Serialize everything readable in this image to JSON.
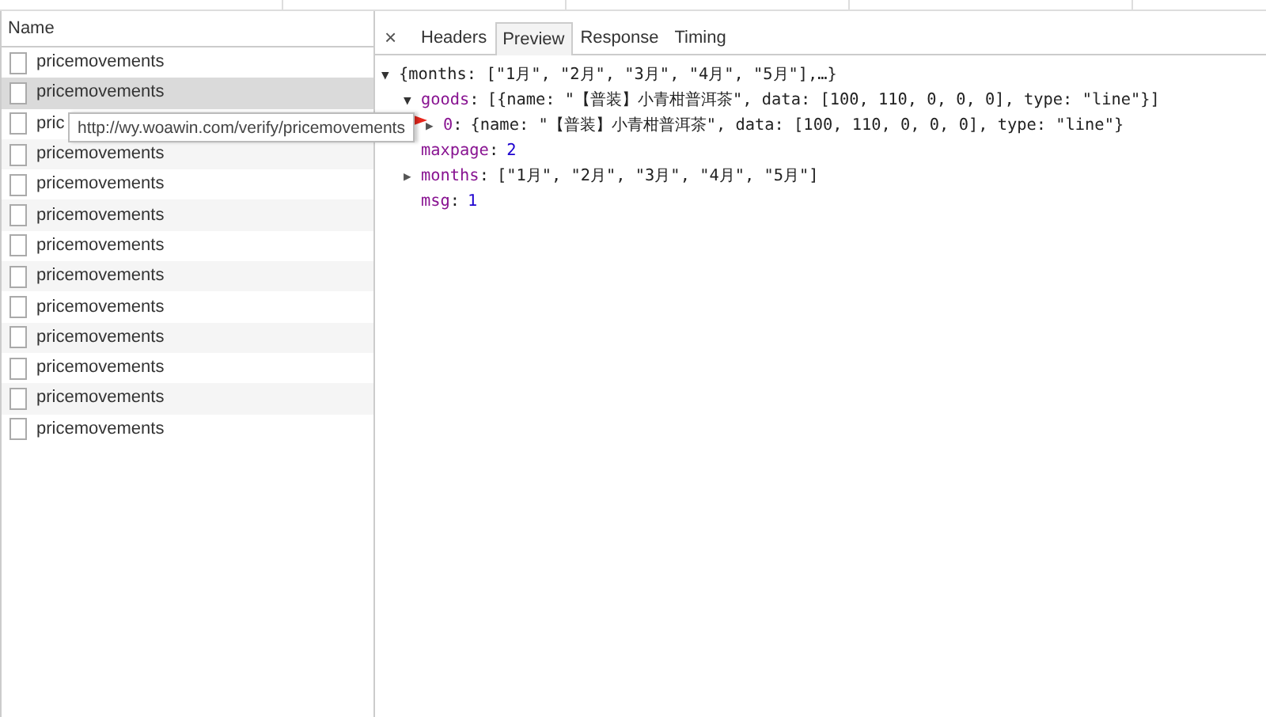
{
  "requests": {
    "column_header": "Name",
    "rows": [
      {
        "name": "pricemovements",
        "selected": false
      },
      {
        "name": "pricemovements",
        "selected": true
      },
      {
        "name": "pric",
        "selected": false
      },
      {
        "name": "pricemovements",
        "selected": false
      },
      {
        "name": "pricemovements",
        "selected": false
      },
      {
        "name": "pricemovements",
        "selected": false
      },
      {
        "name": "pricemovements",
        "selected": false
      },
      {
        "name": "pricemovements",
        "selected": false
      },
      {
        "name": "pricemovements",
        "selected": false
      },
      {
        "name": "pricemovements",
        "selected": false
      },
      {
        "name": "pricemovements",
        "selected": false
      },
      {
        "name": "pricemovements",
        "selected": false
      },
      {
        "name": "pricemovements",
        "selected": false
      }
    ],
    "tooltip": "http://wy.woawin.com/verify/pricemovements"
  },
  "details": {
    "close": "×",
    "tabs": [
      {
        "label": "Headers",
        "selected": false
      },
      {
        "label": "Preview",
        "selected": true
      },
      {
        "label": "Response",
        "selected": false
      },
      {
        "label": "Timing",
        "selected": false
      }
    ],
    "tree": [
      {
        "twisty": "▼",
        "value": "{months: [\"1月\", \"2月\", \"3月\", \"4月\", \"5月\"],…}",
        "kind": "text",
        "expanded": true,
        "children": [
          {
            "twisty": "▼",
            "key": "goods",
            "sep": ":",
            "value": "[{name: \"【普装】小青柑普洱茶\", data: [100, 110, 0, 0, 0], type: \"line\"}]",
            "kind": "text",
            "expanded": true,
            "children": [
              {
                "twisty": "▶",
                "key": "0",
                "sep": ":",
                "value": "{name: \"【普装】小青柑普洱茶\", data: [100, 110, 0, 0, 0], type: \"line\"}",
                "kind": "text",
                "expanded": false,
                "pointed": true
              }
            ]
          },
          {
            "key": "maxpage",
            "sep": ":",
            "value": "2",
            "kind": "number"
          },
          {
            "twisty": "▶",
            "key": "months",
            "sep": ":",
            "value": "[\"1月\", \"2月\", \"3月\", \"4月\", \"5月\"]",
            "kind": "text",
            "expanded": false
          },
          {
            "key": "msg",
            "sep": ":",
            "value": "1",
            "kind": "number"
          }
        ]
      }
    ]
  }
}
